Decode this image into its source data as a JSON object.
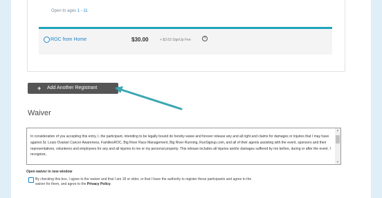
{
  "registration": {
    "age_note_prefix": "Open to ages ",
    "age_note_range": "1 - 11",
    "option": {
      "label": "ROC from Home",
      "price": "$30.00",
      "fee": "+ $3.63 SignUp Fee"
    },
    "add_button_label": "Add Another Registrant"
  },
  "waiver": {
    "title": "Waiver",
    "text": "In consideration of you accepting this entry, I, the participant, intending to be legally bound do hereby waive and forever release any and all right and claims for damages or injuries that I may have against St. Louis Ovarian Cancer Awareness, FamiliesROC, Big River Race Management, Big River Running, RunSignup.com, and all of their agents assisting with the event, sponsors and their representatives, volunteers and employees for any and all injuries to me or my personal property. This release includes all injuries and/or damages suffered by me before, during or after the event. I recognize,",
    "open_new_window": "Open waiver in new window",
    "agree_text": "By checking this box, I agree to the waiver and that I am 18 or older, or that I have the authority to register these participants and agree to the waiver for them, and agree to the ",
    "privacy_policy": "Privacy Policy",
    "agree_end": "."
  },
  "colors": {
    "accent": "#1c83c6",
    "option_border": "#1ea3bc",
    "button_bg": "#555555",
    "annotation_arrow": "#3ba7b2"
  }
}
